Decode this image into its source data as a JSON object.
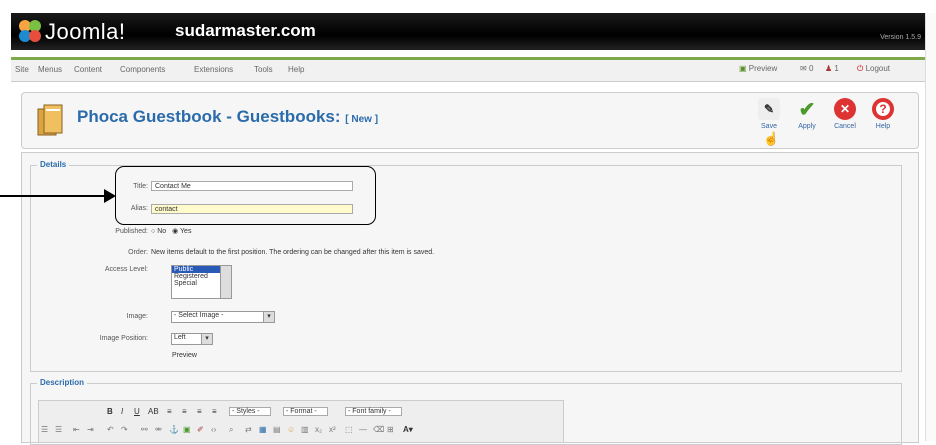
{
  "header": {
    "logo_text": "Joomla!",
    "site_name": "sudarmaster.com",
    "version": "Version 1.5.9"
  },
  "menu": {
    "items": [
      "Site",
      "Menus",
      "Content",
      "Components",
      "Extensions",
      "Tools",
      "Help"
    ],
    "preview": "Preview",
    "messages_count": "0",
    "users_count": "1",
    "logout": "Logout"
  },
  "toolbar": {
    "title": "Phoca Guestbook - Guestbooks:",
    "title_suffix": "[ New ]",
    "save": "Save",
    "apply": "Apply",
    "cancel": "Cancel",
    "help": "Help"
  },
  "details": {
    "legend": "Details",
    "title_label": "Title:",
    "title_value": "Contact Me",
    "alias_label": "Alias:",
    "alias_value": "contact",
    "published_label": "Published:",
    "published_no": "No",
    "published_yes": "Yes",
    "published_selected": "Yes",
    "order_label": "Order:",
    "order_text": "New items default to the first position. The ordering can be changed after this item is saved.",
    "access_label": "Access Level:",
    "access_options": [
      "Public",
      "Registered",
      "Special"
    ],
    "access_selected": "Public",
    "image_label": "Image:",
    "image_value": "- Select Image -",
    "image_position_label": "Image Position:",
    "image_position_value": "Left",
    "preview_label": "Preview"
  },
  "description": {
    "legend": "Description",
    "styles": "- Styles -",
    "format": "- Format -",
    "font_family": "- Font family -"
  },
  "colors": {
    "topbar": "#000000",
    "accent_green": "#7dab4b",
    "title_blue": "#2a6bab"
  }
}
